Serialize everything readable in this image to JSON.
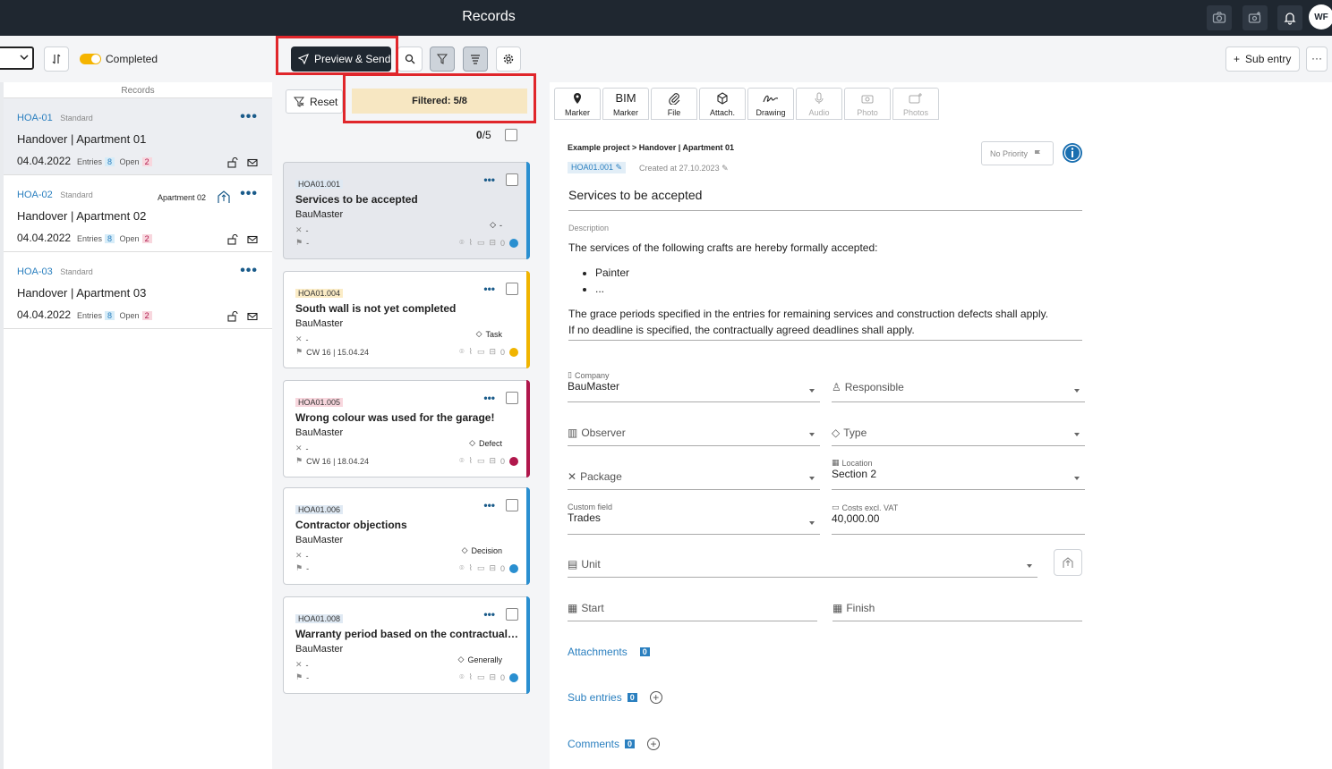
{
  "header": {
    "title": "Records",
    "avatar": "WF",
    "icons": [
      "camera-icon",
      "add-photo-icon",
      "bell-icon"
    ]
  },
  "toolbar": {
    "toggle_label": "Completed",
    "toggle_on": true,
    "preview_send_label": "Preview & Send",
    "sub_entry_label": "Sub entry",
    "more_label": "···",
    "accent": "#f5b400"
  },
  "left": {
    "heading": "Records",
    "records": [
      {
        "id": "HOA-01",
        "type": "Standard",
        "name": "Handover | Apartment 01",
        "date": "04.04.2022",
        "entries_label": "Entries",
        "entries": "8",
        "open_label": "Open",
        "open": "2",
        "apartment": ""
      },
      {
        "id": "HOA-02",
        "type": "Standard",
        "name": "Handover | Apartment 02",
        "date": "04.04.2022",
        "entries_label": "Entries",
        "entries": "8",
        "open_label": "Open",
        "open": "2",
        "apartment": "Apartment 02"
      },
      {
        "id": "HOA-03",
        "type": "Standard",
        "name": "Handover | Apartment 03",
        "date": "04.04.2022",
        "entries_label": "Entries",
        "entries": "8",
        "open_label": "Open",
        "open": "2",
        "apartment": ""
      }
    ]
  },
  "middle": {
    "reset_label": "Reset",
    "filter_label": "Filtered: 5/8",
    "count_selected": "0",
    "count_total": "/5",
    "cards": [
      {
        "id": "HOA01.001",
        "title": "Services to be accepted",
        "company": "BauMaster",
        "assignee": "-",
        "deadline": "-",
        "tag": "-",
        "comments": "0",
        "color": "#2a8fd0",
        "status_color": "#2a8fd0",
        "id_bg": "#dfe9f3",
        "id_color": "#333"
      },
      {
        "id": "HOA01.004",
        "title": "South wall is not yet completed",
        "company": "BauMaster",
        "assignee": "-",
        "deadline": "CW 16 | 15.04.24",
        "tag": "Task",
        "comments": "0",
        "color": "#f0b400",
        "status_color": "#f0b400",
        "id_bg": "#fbecc6",
        "id_color": "#333"
      },
      {
        "id": "HOA01.005",
        "title": "Wrong colour was used for the garage!",
        "company": "BauMaster",
        "assignee": "-",
        "deadline": "CW 16 | 18.04.24",
        "tag": "Defect",
        "comments": "0",
        "color": "#b0174c",
        "status_color": "#b0174c",
        "id_bg": "#f8d7de",
        "id_color": "#333"
      },
      {
        "id": "HOA01.006",
        "title": "Contractor objections",
        "company": "BauMaster",
        "assignee": "-",
        "deadline": "-",
        "tag": "Decision",
        "comments": "0",
        "color": "#2a8fd0",
        "status_color": "#2a8fd0",
        "id_bg": "#dfe9f3",
        "id_color": "#333"
      },
      {
        "id": "HOA01.008",
        "title": "Warranty period based on the contractual agreement",
        "company": "BauMaster",
        "assignee": "-",
        "deadline": "-",
        "tag": "Generally",
        "comments": "0",
        "color": "#2a8fd0",
        "status_color": "#2a8fd0",
        "id_bg": "#dfe9f3",
        "id_color": "#333"
      }
    ]
  },
  "tools": [
    {
      "label": "Marker",
      "top": "",
      "icon": "pin-icon",
      "enabled": true
    },
    {
      "label": "Marker",
      "top": "BIM",
      "icon": "",
      "enabled": true
    },
    {
      "label": "File",
      "top": "",
      "icon": "paperclip-icon",
      "enabled": true
    },
    {
      "label": "Attach.",
      "top": "",
      "icon": "cube-icon",
      "enabled": true
    },
    {
      "label": "Drawing",
      "top": "",
      "icon": "signature-icon",
      "enabled": true
    },
    {
      "label": "Audio",
      "top": "",
      "icon": "mic-icon",
      "enabled": false
    },
    {
      "label": "Photo",
      "top": "",
      "icon": "camera-icon",
      "enabled": false
    },
    {
      "label": "Photos",
      "top": "",
      "icon": "add-photo-icon",
      "enabled": false
    }
  ],
  "detail": {
    "breadcrumb": "Example project > Handover | Apartment 01",
    "priority_label": "No Priority",
    "id": "HOA01.001",
    "created": "Created at 27.10.2023",
    "title": "Services to be accepted",
    "description_label": "Description",
    "description_intro": "The services of the following crafts are hereby formally accepted:",
    "description_list": [
      "Painter",
      "..."
    ],
    "description_p1": "The grace periods specified in the entries for remaining services and construction defects shall apply.",
    "description_p2": "If no deadline is specified, the contractually agreed deadlines shall apply.",
    "company_label": "Company",
    "company_value": "BauMaster",
    "responsible_placeholder": "Responsible",
    "observer_placeholder": "Observer",
    "type_placeholder": "Type",
    "package_placeholder": "Package",
    "location_label": "Location",
    "location_value": "Section 2",
    "custom_label": "Custom field",
    "custom_value": "Trades",
    "costs_label": "Costs excl. VAT",
    "costs_value": "40,000.00",
    "unit_placeholder": "Unit",
    "start_placeholder": "Start",
    "finish_placeholder": "Finish",
    "attachments_label": "Attachments",
    "attachments_count": "0",
    "subentries_label": "Sub entries",
    "subentries_count": "0",
    "comments_label": "Comments",
    "comments_count": "0"
  }
}
